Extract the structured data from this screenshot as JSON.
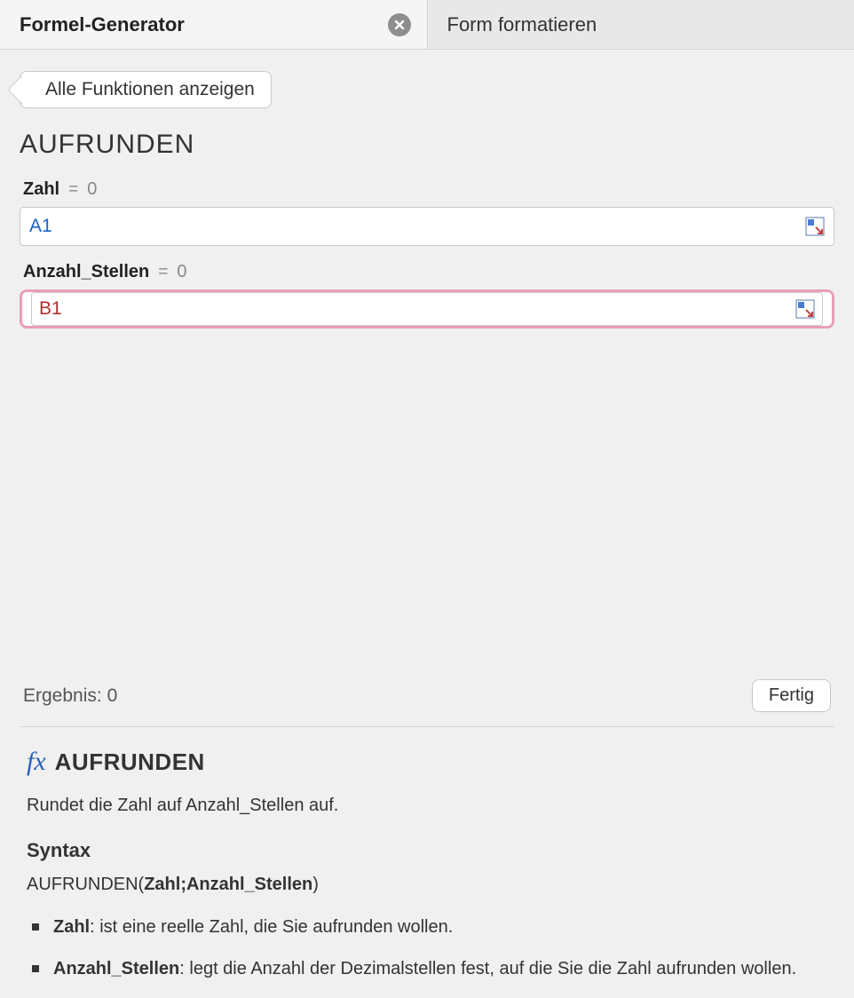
{
  "tabs": {
    "active": "Formel-Generator",
    "inactive": "Form formatieren"
  },
  "breadcrumb": "Alle Funktionen anzeigen",
  "functionName": "AUFRUNDEN",
  "params": [
    {
      "name": "Zahl",
      "eq": "=",
      "valuePreview": "0",
      "input": "A1",
      "focused": false,
      "colorClass": "blue"
    },
    {
      "name": "Anzahl_Stellen",
      "eq": "=",
      "valuePreview": "0",
      "input": "B1",
      "focused": true,
      "colorClass": "red"
    }
  ],
  "resultLabel": "Ergebnis:",
  "resultValue": "0",
  "doneLabel": "Fertig",
  "doc": {
    "fx": "fx",
    "title": "AUFRUNDEN",
    "description": "Rundet die Zahl auf Anzahl_Stellen auf.",
    "syntaxHeading": "Syntax",
    "signaturePrefix": "AUFRUNDEN(",
    "signatureArgs": "Zahl;Anzahl_Stellen",
    "signatureSuffix": ")",
    "args": [
      {
        "name": "Zahl",
        "desc": ": ist eine reelle Zahl, die Sie aufrunden wollen."
      },
      {
        "name": "Anzahl_Stellen",
        "desc": ": legt die Anzahl der Dezimalstellen fest, auf die Sie die Zahl aufrunden wollen."
      }
    ]
  }
}
